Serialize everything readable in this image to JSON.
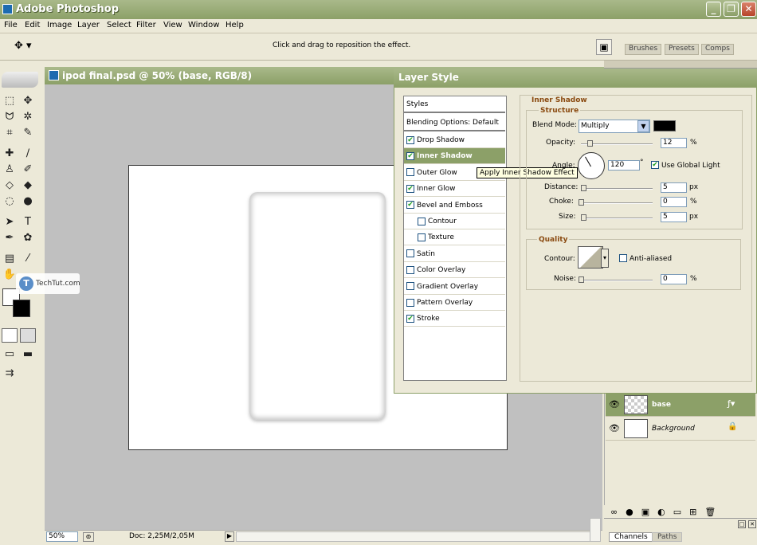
{
  "window": {
    "title": "Adobe Photoshop"
  },
  "menu": [
    "File",
    "Edit",
    "Image",
    "Layer",
    "Select",
    "Filter",
    "View",
    "Window",
    "Help"
  ],
  "options_bar": {
    "hint": "Click and drag to reposition the effect.",
    "tabs": [
      "Brushes",
      "Presets",
      "Comps"
    ]
  },
  "document": {
    "title": "ipod final.psd @ 50% (base, RGB/8)"
  },
  "watermark": "TechTut.com",
  "status": {
    "zoom": "50%",
    "doc": "Doc: 2,25M/2,05M"
  },
  "layer_style": {
    "title": "Layer Style",
    "styles_header": "Styles",
    "blending": "Blending Options: Default",
    "effects": [
      {
        "label": "Drop Shadow",
        "checked": true
      },
      {
        "label": "Inner Shadow",
        "checked": true,
        "selected": true
      },
      {
        "label": "Outer Glow",
        "checked": false
      },
      {
        "label": "Inner Glow",
        "checked": true
      },
      {
        "label": "Bevel and Emboss",
        "checked": true
      },
      {
        "label": "Contour",
        "checked": false,
        "indent": true
      },
      {
        "label": "Texture",
        "checked": false,
        "indent": true
      },
      {
        "label": "Satin",
        "checked": false
      },
      {
        "label": "Color Overlay",
        "checked": false
      },
      {
        "label": "Gradient Overlay",
        "checked": false
      },
      {
        "label": "Pattern Overlay",
        "checked": false
      },
      {
        "label": "Stroke",
        "checked": true
      }
    ],
    "tooltip": "Apply Inner Shadow Effect",
    "section_title": "Inner Shadow",
    "structure": {
      "title": "Structure",
      "blend_mode_label": "Blend Mode:",
      "blend_mode": "Multiply",
      "shadow_color": "#000000",
      "opacity_label": "Opacity:",
      "opacity": "12",
      "angle_label": "Angle:",
      "angle": "120",
      "use_global_light": "Use Global Light",
      "distance_label": "Distance:",
      "distance": "5",
      "choke_label": "Choke:",
      "choke": "0",
      "size_label": "Size:",
      "size": "5",
      "unit_pct": "%",
      "unit_px": "px",
      "degree": "°"
    },
    "quality": {
      "title": "Quality",
      "contour_label": "Contour:",
      "anti_aliased": "Anti-aliased",
      "noise_label": "Noise:",
      "noise": "0",
      "unit_pct": "%"
    }
  },
  "layers": [
    {
      "name": "base",
      "selected": true
    },
    {
      "name": "Background",
      "locked": true
    }
  ],
  "bottom_tabs": [
    "Channels",
    "Paths"
  ]
}
